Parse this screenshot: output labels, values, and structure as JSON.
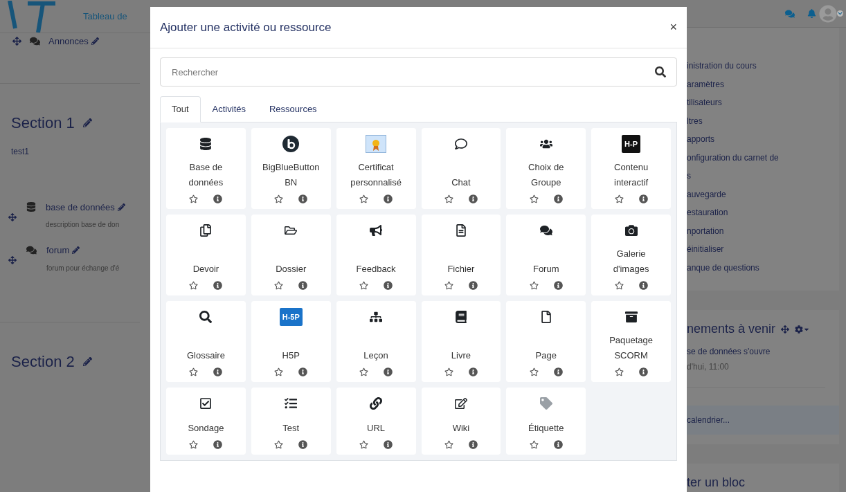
{
  "header": {
    "link": "Tableau de"
  },
  "course": {
    "announcements": "Annonces",
    "sections": [
      {
        "title": "Section 1",
        "summary": "test1",
        "activities": [
          {
            "kind": "database",
            "name": "base de données",
            "description": "description base de don"
          },
          {
            "kind": "forum",
            "name": "forum",
            "description": "forum pour échange d'é"
          }
        ]
      },
      {
        "title": "Section 2"
      }
    ]
  },
  "admin": {
    "items": [
      "inistration du cours",
      "aramètres",
      "tilisateurs",
      "ltres",
      "apports",
      "onfiguration du carnet de",
      "s",
      "auvegarde",
      "estauration",
      "nportation",
      "éinitialiser",
      "anque de questions"
    ]
  },
  "events": {
    "title": "nements à venir",
    "event": "se de données s'ouvre",
    "time": "d'hui, 11:00",
    "link": "calendrier..."
  },
  "add_block": {
    "title": "ter un bloc"
  },
  "dialog": {
    "title": "Ajouter une activité ou ressource",
    "close": "×",
    "search": {
      "placeholder": "Rechercher"
    },
    "tabs": [
      {
        "label": "Tout",
        "selected": true
      },
      {
        "label": "Activités",
        "selected": false
      },
      {
        "label": "Ressources",
        "selected": false
      }
    ],
    "tiles": [
      {
        "label": "Base de données"
      },
      {
        "label": "BigBlueButtonBN"
      },
      {
        "label": "Certificat personnalisé"
      },
      {
        "label": "Chat"
      },
      {
        "label": "Choix de Groupe"
      },
      {
        "label": "Contenu interactif",
        "badge": {
          "text": "H-P",
          "color": "#111111"
        }
      },
      {
        "label": "Devoir"
      },
      {
        "label": "Dossier"
      },
      {
        "label": "Feedback"
      },
      {
        "label": "Fichier"
      },
      {
        "label": "Forum"
      },
      {
        "label": "Galerie d'images"
      },
      {
        "label": "Glossaire"
      },
      {
        "label": "H5P",
        "badge": {
          "text": "H-5P",
          "color": "#1a73c9"
        }
      },
      {
        "label": "Leçon"
      },
      {
        "label": "Livre"
      },
      {
        "label": "Page"
      },
      {
        "label": "Paquetage SCORM"
      },
      {
        "label": "Sondage"
      },
      {
        "label": "Test"
      },
      {
        "label": "URL"
      },
      {
        "label": "Wiki"
      },
      {
        "label": "Étiquette"
      }
    ]
  }
}
